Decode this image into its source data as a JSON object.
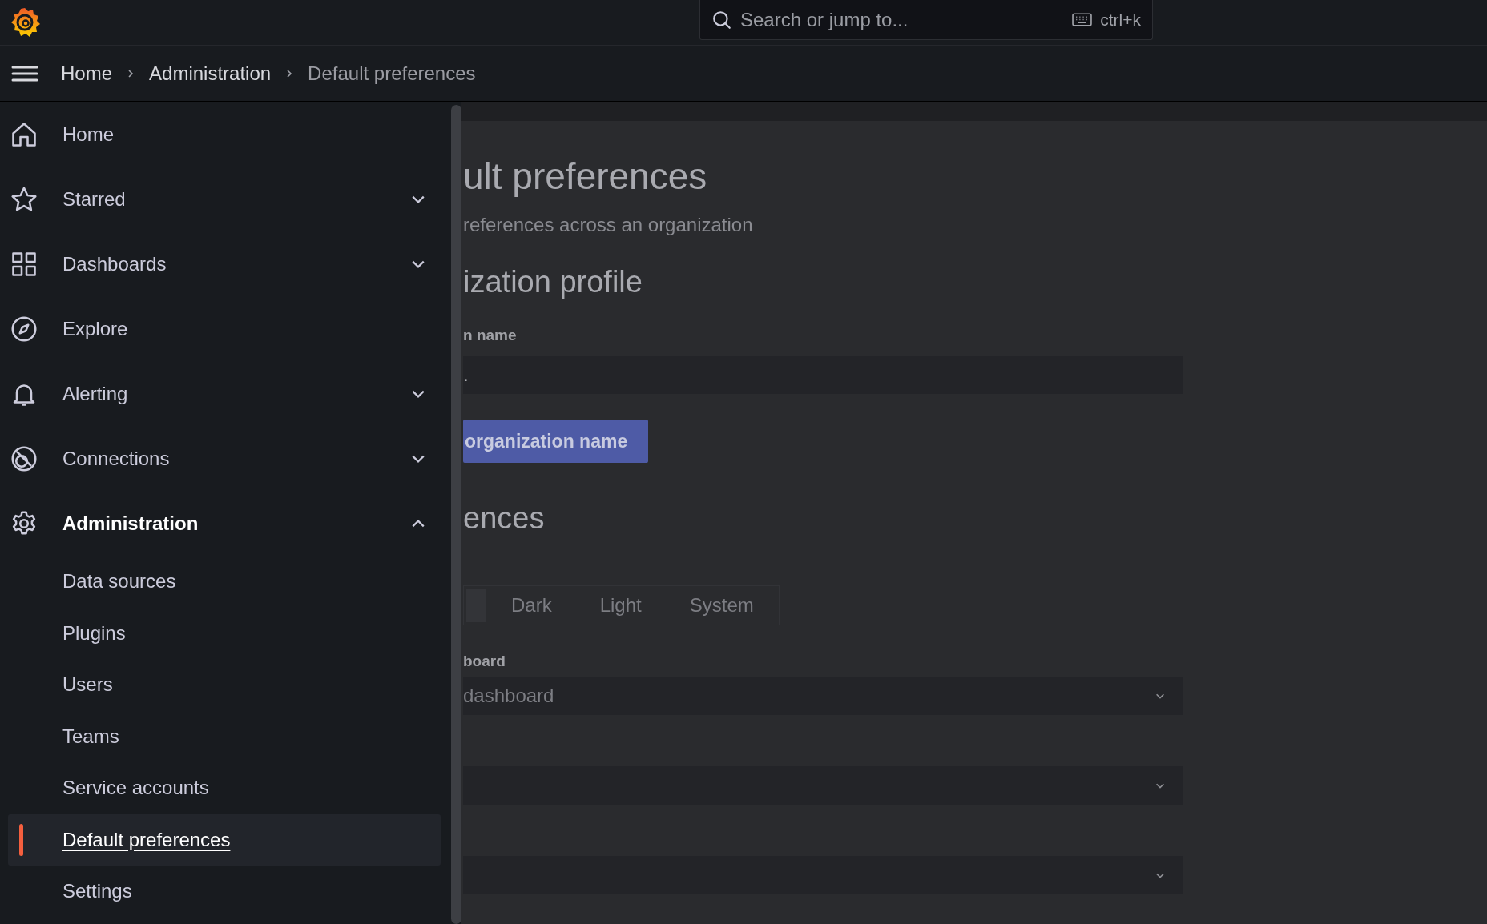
{
  "top_bar": {
    "search": {
      "placeholder": "Search or jump to...",
      "shortcut": "ctrl+k"
    }
  },
  "breadcrumbs": [
    {
      "label": "Home",
      "current": false
    },
    {
      "label": "Administration",
      "current": false
    },
    {
      "label": "Default preferences",
      "current": true
    }
  ],
  "sidebar": {
    "items": [
      {
        "label": "Home"
      },
      {
        "label": "Starred",
        "expanded": false
      },
      {
        "label": "Dashboards",
        "expanded": false
      },
      {
        "label": "Explore"
      },
      {
        "label": "Alerting",
        "expanded": false
      },
      {
        "label": "Connections",
        "expanded": false
      },
      {
        "label": "Administration",
        "expanded": true,
        "children": [
          {
            "label": "Data sources",
            "selected": false
          },
          {
            "label": "Plugins",
            "selected": false
          },
          {
            "label": "Users",
            "selected": false
          },
          {
            "label": "Teams",
            "selected": false
          },
          {
            "label": "Service accounts",
            "selected": false
          },
          {
            "label": "Default preferences",
            "selected": true
          },
          {
            "label": "Settings",
            "selected": false
          }
        ]
      }
    ]
  },
  "page": {
    "title": "ult preferences",
    "subtitle": "references across an organization",
    "profile": {
      "heading": "ization profile",
      "field_label": "n name",
      "field_value": ".",
      "button": "organization name"
    },
    "preferences": {
      "heading": "ences",
      "theme_options": [
        {
          "selected": true
        },
        {
          "label": "Dark",
          "selected": false
        },
        {
          "label": "Light",
          "selected": false
        },
        {
          "label": "System",
          "selected": false
        }
      ],
      "fields": [
        {
          "kind": "select",
          "label": "board",
          "value": "dashboard"
        },
        {
          "kind": "select"
        },
        {
          "kind": "select"
        }
      ]
    }
  }
}
